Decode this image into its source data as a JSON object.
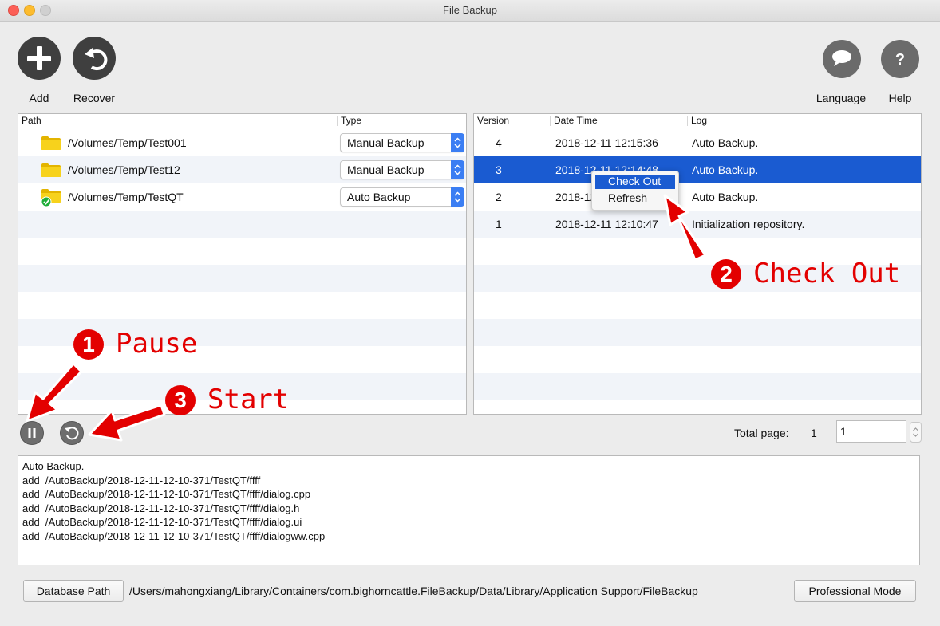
{
  "window": {
    "title": "File Backup"
  },
  "toolbar": {
    "add_label": "Add",
    "recover_label": "Recover",
    "language_label": "Language",
    "help_label": "Help"
  },
  "paths_table": {
    "headers": {
      "path": "Path",
      "type": "Type"
    },
    "rows": [
      {
        "path": "/Volumes/Temp/Test001",
        "type": "Manual Backup",
        "icon": "folder-icon"
      },
      {
        "path": "/Volumes/Temp/Test12",
        "type": "Manual Backup",
        "icon": "folder-icon"
      },
      {
        "path": "/Volumes/Temp/TestQT",
        "type": "Auto Backup",
        "icon": "folder-check-icon"
      }
    ]
  },
  "versions_table": {
    "headers": {
      "version": "Version",
      "datetime": "Date Time",
      "log": "Log"
    },
    "rows": [
      {
        "version": "4",
        "datetime": "2018-12-11 12:15:36",
        "log": "Auto Backup."
      },
      {
        "version": "3",
        "datetime": "2018-12-11 12:14:48",
        "log": "Auto Backup.",
        "selected": true
      },
      {
        "version": "2",
        "datetime": "2018-12-11 12:12:xx",
        "log": "Auto Backup."
      },
      {
        "version": "1",
        "datetime": "2018-12-11 12:10:47",
        "log": "Initialization repository."
      }
    ]
  },
  "context_menu": {
    "items": [
      "Check Out",
      "Refresh"
    ]
  },
  "annotations": {
    "pause": {
      "num": "1",
      "text": "Pause"
    },
    "checkout": {
      "num": "2",
      "text": "Check Out"
    },
    "start": {
      "num": "3",
      "text": "Start"
    }
  },
  "pager": {
    "label": "Total page:",
    "total": "1",
    "current": "1"
  },
  "log_lines": [
    "Auto Backup.",
    "add  /AutoBackup/2018-12-11-12-10-371/TestQT/ffff",
    "add  /AutoBackup/2018-12-11-12-10-371/TestQT/ffff/dialog.cpp",
    "add  /AutoBackup/2018-12-11-12-10-371/TestQT/ffff/dialog.h",
    "add  /AutoBackup/2018-12-11-12-10-371/TestQT/ffff/dialog.ui",
    "add  /AutoBackup/2018-12-11-12-10-371/TestQT/ffff/dialogww.cpp"
  ],
  "footer": {
    "db_button": "Database Path",
    "db_path": "/Users/mahongxiang/Library/Containers/com.bighorncattle.FileBackup/Data/Library/Application Support/FileBackup",
    "pro_button": "Professional Mode"
  },
  "colors": {
    "selection": "#1a5bd1",
    "annotation": "#e30000",
    "accent": "#3b7ef3"
  }
}
